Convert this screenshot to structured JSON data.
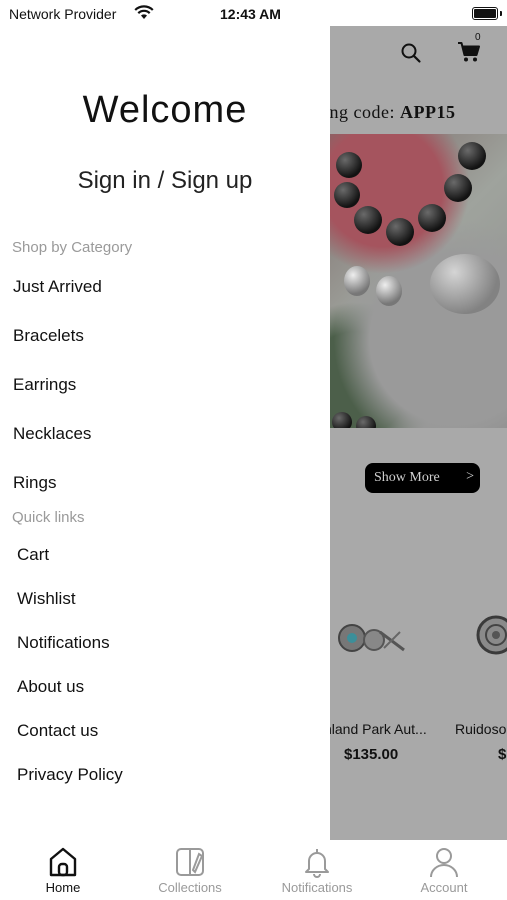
{
  "status_bar": {
    "carrier": "Network Provider",
    "time": "12:43 AM"
  },
  "background": {
    "cart_count": "0",
    "promo_text_prefix": "ing code: ",
    "promo_code": "APP15",
    "show_more_label": "Show More",
    "show_more_chevron": ">",
    "products": [
      {
        "name": "nland Park Aut...",
        "price": "$135.00"
      },
      {
        "name": "Ruidoso",
        "price": "$"
      }
    ]
  },
  "drawer": {
    "welcome": "Welcome",
    "sign_in": "Sign in / Sign up",
    "shop_by_category_title": "Shop by Category",
    "categories": [
      "Just Arrived",
      "Bracelets",
      "Earrings",
      "Necklaces",
      "Rings"
    ],
    "quick_links_title": "Quick links",
    "quick_links": [
      "Cart",
      "Wishlist",
      "Notifications",
      "About us",
      "Contact us",
      "Privacy Policy"
    ]
  },
  "tab_bar": [
    {
      "label": "Home",
      "icon": "home-icon",
      "active": true
    },
    {
      "label": "Collections",
      "icon": "collections-icon",
      "active": false
    },
    {
      "label": "Notifications",
      "icon": "bell-icon",
      "active": false
    },
    {
      "label": "Account",
      "icon": "person-icon",
      "active": false
    }
  ]
}
